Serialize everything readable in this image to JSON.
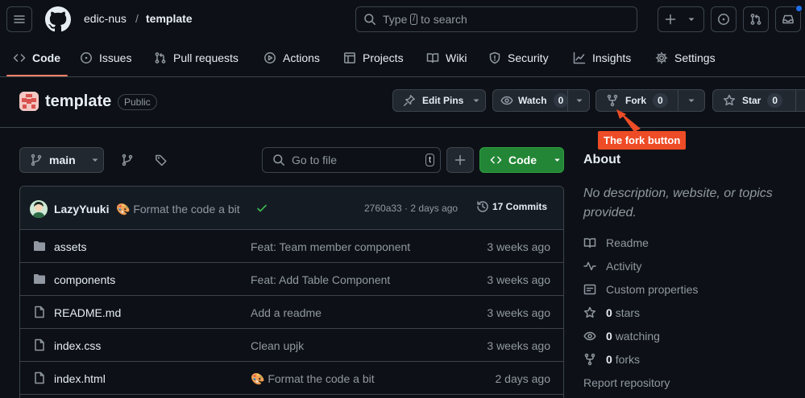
{
  "header": {
    "owner": "edic-nus",
    "separator": "/",
    "repo": "template",
    "search_prefix": "Type",
    "search_key": "/",
    "search_suffix": "to search"
  },
  "nav": {
    "tabs": [
      {
        "label": "Code",
        "icon": "code-icon",
        "active": true
      },
      {
        "label": "Issues",
        "icon": "issue-icon"
      },
      {
        "label": "Pull requests",
        "icon": "pull-request-icon"
      },
      {
        "label": "Actions",
        "icon": "play-icon"
      },
      {
        "label": "Projects",
        "icon": "table-icon"
      },
      {
        "label": "Wiki",
        "icon": "book-icon"
      },
      {
        "label": "Security",
        "icon": "shield-icon"
      },
      {
        "label": "Insights",
        "icon": "graph-icon"
      },
      {
        "label": "Settings",
        "icon": "gear-icon"
      }
    ]
  },
  "repohead": {
    "title": "template",
    "visibility": "Public",
    "edit_pins": "Edit Pins",
    "watch_label": "Watch",
    "watch_count": "0",
    "fork_label": "Fork",
    "fork_count": "0",
    "star_label": "Star",
    "star_count": "0"
  },
  "annotation": {
    "text": "The fork button",
    "color": "#ee4c26"
  },
  "toolbar": {
    "branch": "main",
    "goto_placeholder": "Go to file",
    "goto_key": "t",
    "code_label": "Code"
  },
  "commit": {
    "user": "LazyYuuki",
    "message": "🎨 Format the code a bit",
    "sha_date": "2760a33 · 2 days ago",
    "commits": "17 Commits"
  },
  "files": [
    {
      "type": "folder",
      "name": "assets",
      "message": "Feat: Team member component",
      "date": "3 weeks ago"
    },
    {
      "type": "folder",
      "name": "components",
      "message": "Feat: Add Table Component",
      "date": "3 weeks ago"
    },
    {
      "type": "file",
      "name": "README.md",
      "message": "Add a readme",
      "date": "3 weeks ago"
    },
    {
      "type": "file",
      "name": "index.css",
      "message": "Clean upjk",
      "date": "3 weeks ago"
    },
    {
      "type": "file",
      "name": "index.html",
      "message": "🎨 Format the code a bit",
      "date": "2 days ago"
    }
  ],
  "about": {
    "title": "About",
    "description": "No description, website, or topics provided.",
    "readme": "Readme",
    "activity": "Activity",
    "custom_properties": "Custom properties",
    "stars_count": "0",
    "stars_label": "stars",
    "watching_count": "0",
    "watching_label": "watching",
    "forks_count": "0",
    "forks_label": "forks",
    "report": "Report repository"
  },
  "colors": {
    "background": "#0d1117",
    "accent_green": "#238636",
    "tab_underline": "#f78166",
    "notification_dot": "#1f6feb"
  }
}
